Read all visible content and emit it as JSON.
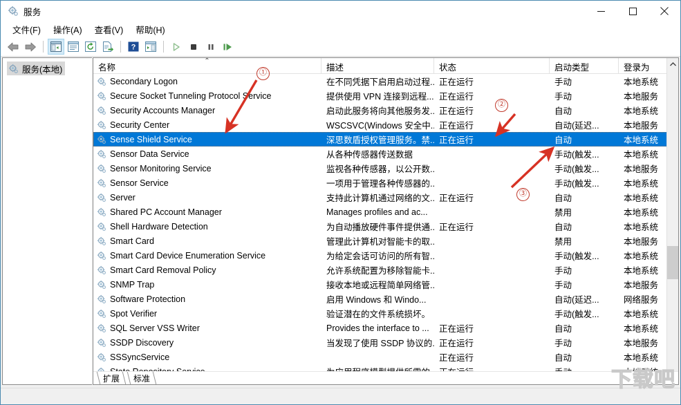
{
  "window": {
    "title": "服务",
    "app_icon": "services-gear-icon",
    "controls": {
      "minimize": "minimize-icon",
      "maximize": "maximize-icon",
      "close": "close-icon"
    }
  },
  "menubar": {
    "items": [
      {
        "label": "文件(F)",
        "accel": "F"
      },
      {
        "label": "操作(A)",
        "accel": "A"
      },
      {
        "label": "查看(V)",
        "accel": "V"
      },
      {
        "label": "帮助(H)",
        "accel": "H"
      }
    ]
  },
  "toolbar": {
    "buttons": [
      {
        "name": "back-arrow-icon",
        "glyph": "back"
      },
      {
        "name": "forward-arrow-icon",
        "glyph": "forward"
      },
      {
        "name": "show-hide-console-tree-icon",
        "glyph": "tree",
        "active": true
      },
      {
        "name": "properties-icon",
        "glyph": "properties"
      },
      {
        "name": "refresh-icon",
        "glyph": "refresh"
      },
      {
        "name": "export-list-icon",
        "glyph": "export"
      },
      {
        "name": "help-icon",
        "glyph": "help"
      },
      {
        "name": "show-action-pane-icon",
        "glyph": "actionpane"
      },
      {
        "name": "start-service-icon",
        "glyph": "start"
      },
      {
        "name": "stop-service-icon",
        "glyph": "stop"
      },
      {
        "name": "pause-service-icon",
        "glyph": "pause"
      },
      {
        "name": "restart-service-icon",
        "glyph": "restart"
      }
    ]
  },
  "tree": {
    "root_label": "服务(本地)",
    "root_icon": "services-gear-icon"
  },
  "list": {
    "columns": [
      {
        "key": "name",
        "label": "名称",
        "sorted": true
      },
      {
        "key": "desc",
        "label": "描述"
      },
      {
        "key": "status",
        "label": "状态"
      },
      {
        "key": "start",
        "label": "启动类型"
      },
      {
        "key": "logon",
        "label": "登录为"
      }
    ],
    "sort_glyph": "⌃",
    "rows": [
      {
        "name": "Secondary Logon",
        "desc": "在不同凭据下启用启动过程...",
        "status": "正在运行",
        "start": "手动",
        "logon": "本地系统",
        "selected": false
      },
      {
        "name": "Secure Socket Tunneling Protocol Service",
        "desc": "提供使用 VPN 连接到远程...",
        "status": "正在运行",
        "start": "手动",
        "logon": "本地服务",
        "selected": false
      },
      {
        "name": "Security Accounts Manager",
        "desc": "启动此服务将向其他服务发...",
        "status": "正在运行",
        "start": "自动",
        "logon": "本地系统",
        "selected": false
      },
      {
        "name": "Security Center",
        "desc": "WSCSVC(Windows 安全中...",
        "status": "正在运行",
        "start": "自动(延迟...",
        "logon": "本地服务",
        "selected": false
      },
      {
        "name": "Sense Shield Service",
        "desc": "深思数盾授权管理服务。禁...",
        "status": "正在运行",
        "start": "自动",
        "logon": "本地系统",
        "selected": true
      },
      {
        "name": "Sensor Data Service",
        "desc": "从各种传感器传送数据",
        "status": "",
        "start": "手动(触发...",
        "logon": "本地系统",
        "selected": false
      },
      {
        "name": "Sensor Monitoring Service",
        "desc": "监视各种传感器，以公开数...",
        "status": "",
        "start": "手动(触发...",
        "logon": "本地服务",
        "selected": false
      },
      {
        "name": "Sensor Service",
        "desc": "一项用于管理各种传感器的...",
        "status": "",
        "start": "手动(触发...",
        "logon": "本地系统",
        "selected": false
      },
      {
        "name": "Server",
        "desc": "支持此计算机通过网络的文...",
        "status": "正在运行",
        "start": "自动",
        "logon": "本地系统",
        "selected": false
      },
      {
        "name": "Shared PC Account Manager",
        "desc": "Manages profiles and ac...",
        "status": "",
        "start": "禁用",
        "logon": "本地系统",
        "selected": false
      },
      {
        "name": "Shell Hardware Detection",
        "desc": "为自动播放硬件事件提供通...",
        "status": "正在运行",
        "start": "自动",
        "logon": "本地系统",
        "selected": false
      },
      {
        "name": "Smart Card",
        "desc": "管理此计算机对智能卡的取...",
        "status": "",
        "start": "禁用",
        "logon": "本地服务",
        "selected": false
      },
      {
        "name": "Smart Card Device Enumeration Service",
        "desc": "为给定会话可访问的所有智...",
        "status": "",
        "start": "手动(触发...",
        "logon": "本地系统",
        "selected": false
      },
      {
        "name": "Smart Card Removal Policy",
        "desc": "允许系统配置为移除智能卡...",
        "status": "",
        "start": "手动",
        "logon": "本地系统",
        "selected": false
      },
      {
        "name": "SNMP Trap",
        "desc": "接收本地或远程简单网络管...",
        "status": "",
        "start": "手动",
        "logon": "本地服务",
        "selected": false
      },
      {
        "name": "Software Protection",
        "desc": "启用 Windows 和 Windo...",
        "status": "",
        "start": "自动(延迟...",
        "logon": "网络服务",
        "selected": false
      },
      {
        "name": "Spot Verifier",
        "desc": "验证潜在的文件系统损坏。",
        "status": "",
        "start": "手动(触发...",
        "logon": "本地系统",
        "selected": false
      },
      {
        "name": "SQL Server VSS Writer",
        "desc": "Provides the interface to ...",
        "status": "正在运行",
        "start": "自动",
        "logon": "本地系统",
        "selected": false
      },
      {
        "name": "SSDP Discovery",
        "desc": "当发现了使用 SSDP 协议的...",
        "status": "正在运行",
        "start": "手动",
        "logon": "本地服务",
        "selected": false
      },
      {
        "name": "SSSyncService",
        "desc": "",
        "status": "正在运行",
        "start": "自动",
        "logon": "本地系统",
        "selected": false
      },
      {
        "name": "State Repository Service",
        "desc": "为应用程序模型提供所需的...",
        "status": "正在运行",
        "start": "手动",
        "logon": "本地系统",
        "selected": false
      }
    ]
  },
  "tabs": [
    {
      "label": "扩展"
    },
    {
      "label": "标准"
    }
  ],
  "annotations": [
    {
      "label": "①",
      "name": "annotation-marker-1"
    },
    {
      "label": "②",
      "name": "annotation-marker-2"
    },
    {
      "label": "③",
      "name": "annotation-marker-3"
    }
  ],
  "watermark": {
    "text": "下载吧"
  },
  "colors": {
    "selection": "#0078d7",
    "annotation": "#c0392b",
    "window_border": "#4a8ab0",
    "toolbar_active": "#d4eaf7"
  }
}
